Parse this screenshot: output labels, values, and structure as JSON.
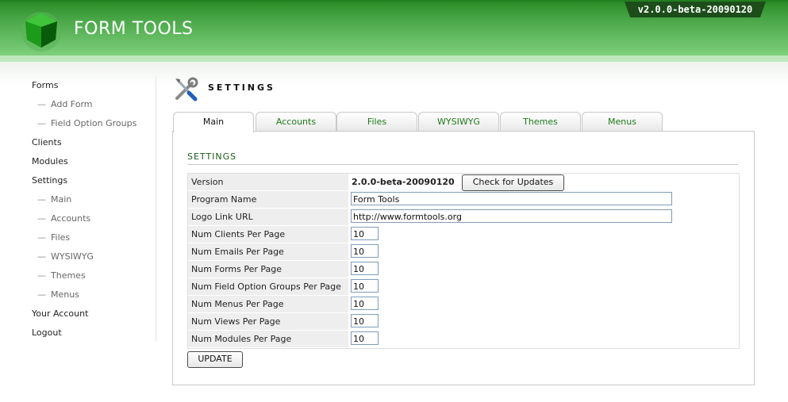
{
  "header": {
    "app_title": "FORM TOOLS",
    "version": "v2.0.0-beta-20090120",
    "brand_color": "#3f9e3d"
  },
  "sidebar": {
    "items": [
      {
        "label": "Forms",
        "sub": false
      },
      {
        "label": "Add Form",
        "sub": true
      },
      {
        "label": "Field Option Groups",
        "sub": true
      },
      {
        "label": "Clients",
        "sub": false
      },
      {
        "label": "Modules",
        "sub": false
      },
      {
        "label": "Settings",
        "sub": false
      },
      {
        "label": "Main",
        "sub": true
      },
      {
        "label": "Accounts",
        "sub": true
      },
      {
        "label": "Files",
        "sub": true
      },
      {
        "label": "WYSIWYG",
        "sub": true
      },
      {
        "label": "Themes",
        "sub": true
      },
      {
        "label": "Menus",
        "sub": true
      },
      {
        "label": "Your Account",
        "sub": false
      },
      {
        "label": "Logout",
        "sub": false
      }
    ],
    "dash": "—"
  },
  "page": {
    "title": "SETTINGS",
    "icon": "tools-icon"
  },
  "tabs": [
    {
      "label": "Main",
      "active": true
    },
    {
      "label": "Accounts",
      "active": false
    },
    {
      "label": "Files",
      "active": false
    },
    {
      "label": "WYSIWYG",
      "active": false
    },
    {
      "label": "Themes",
      "active": false
    },
    {
      "label": "Menus",
      "active": false
    }
  ],
  "settings": {
    "section_title": "SETTINGS",
    "version_label": "Version",
    "version_value": "2.0.0-beta-20090120",
    "check_updates_label": "Check for Updates",
    "program_name_label": "Program Name",
    "program_name_value": "Form Tools",
    "logo_link_label": "Logo Link URL",
    "logo_link_value": "http://www.formtools.org",
    "per_page": [
      {
        "label": "Num Clients Per Page",
        "value": "10"
      },
      {
        "label": "Num Emails Per Page",
        "value": "10"
      },
      {
        "label": "Num Forms Per Page",
        "value": "10"
      },
      {
        "label": "Num Field Option Groups Per Page",
        "value": "10"
      },
      {
        "label": "Num Menus Per Page",
        "value": "10"
      },
      {
        "label": "Num Views Per Page",
        "value": "10"
      },
      {
        "label": "Num Modules Per Page",
        "value": "10"
      }
    ],
    "update_label": "UPDATE"
  }
}
